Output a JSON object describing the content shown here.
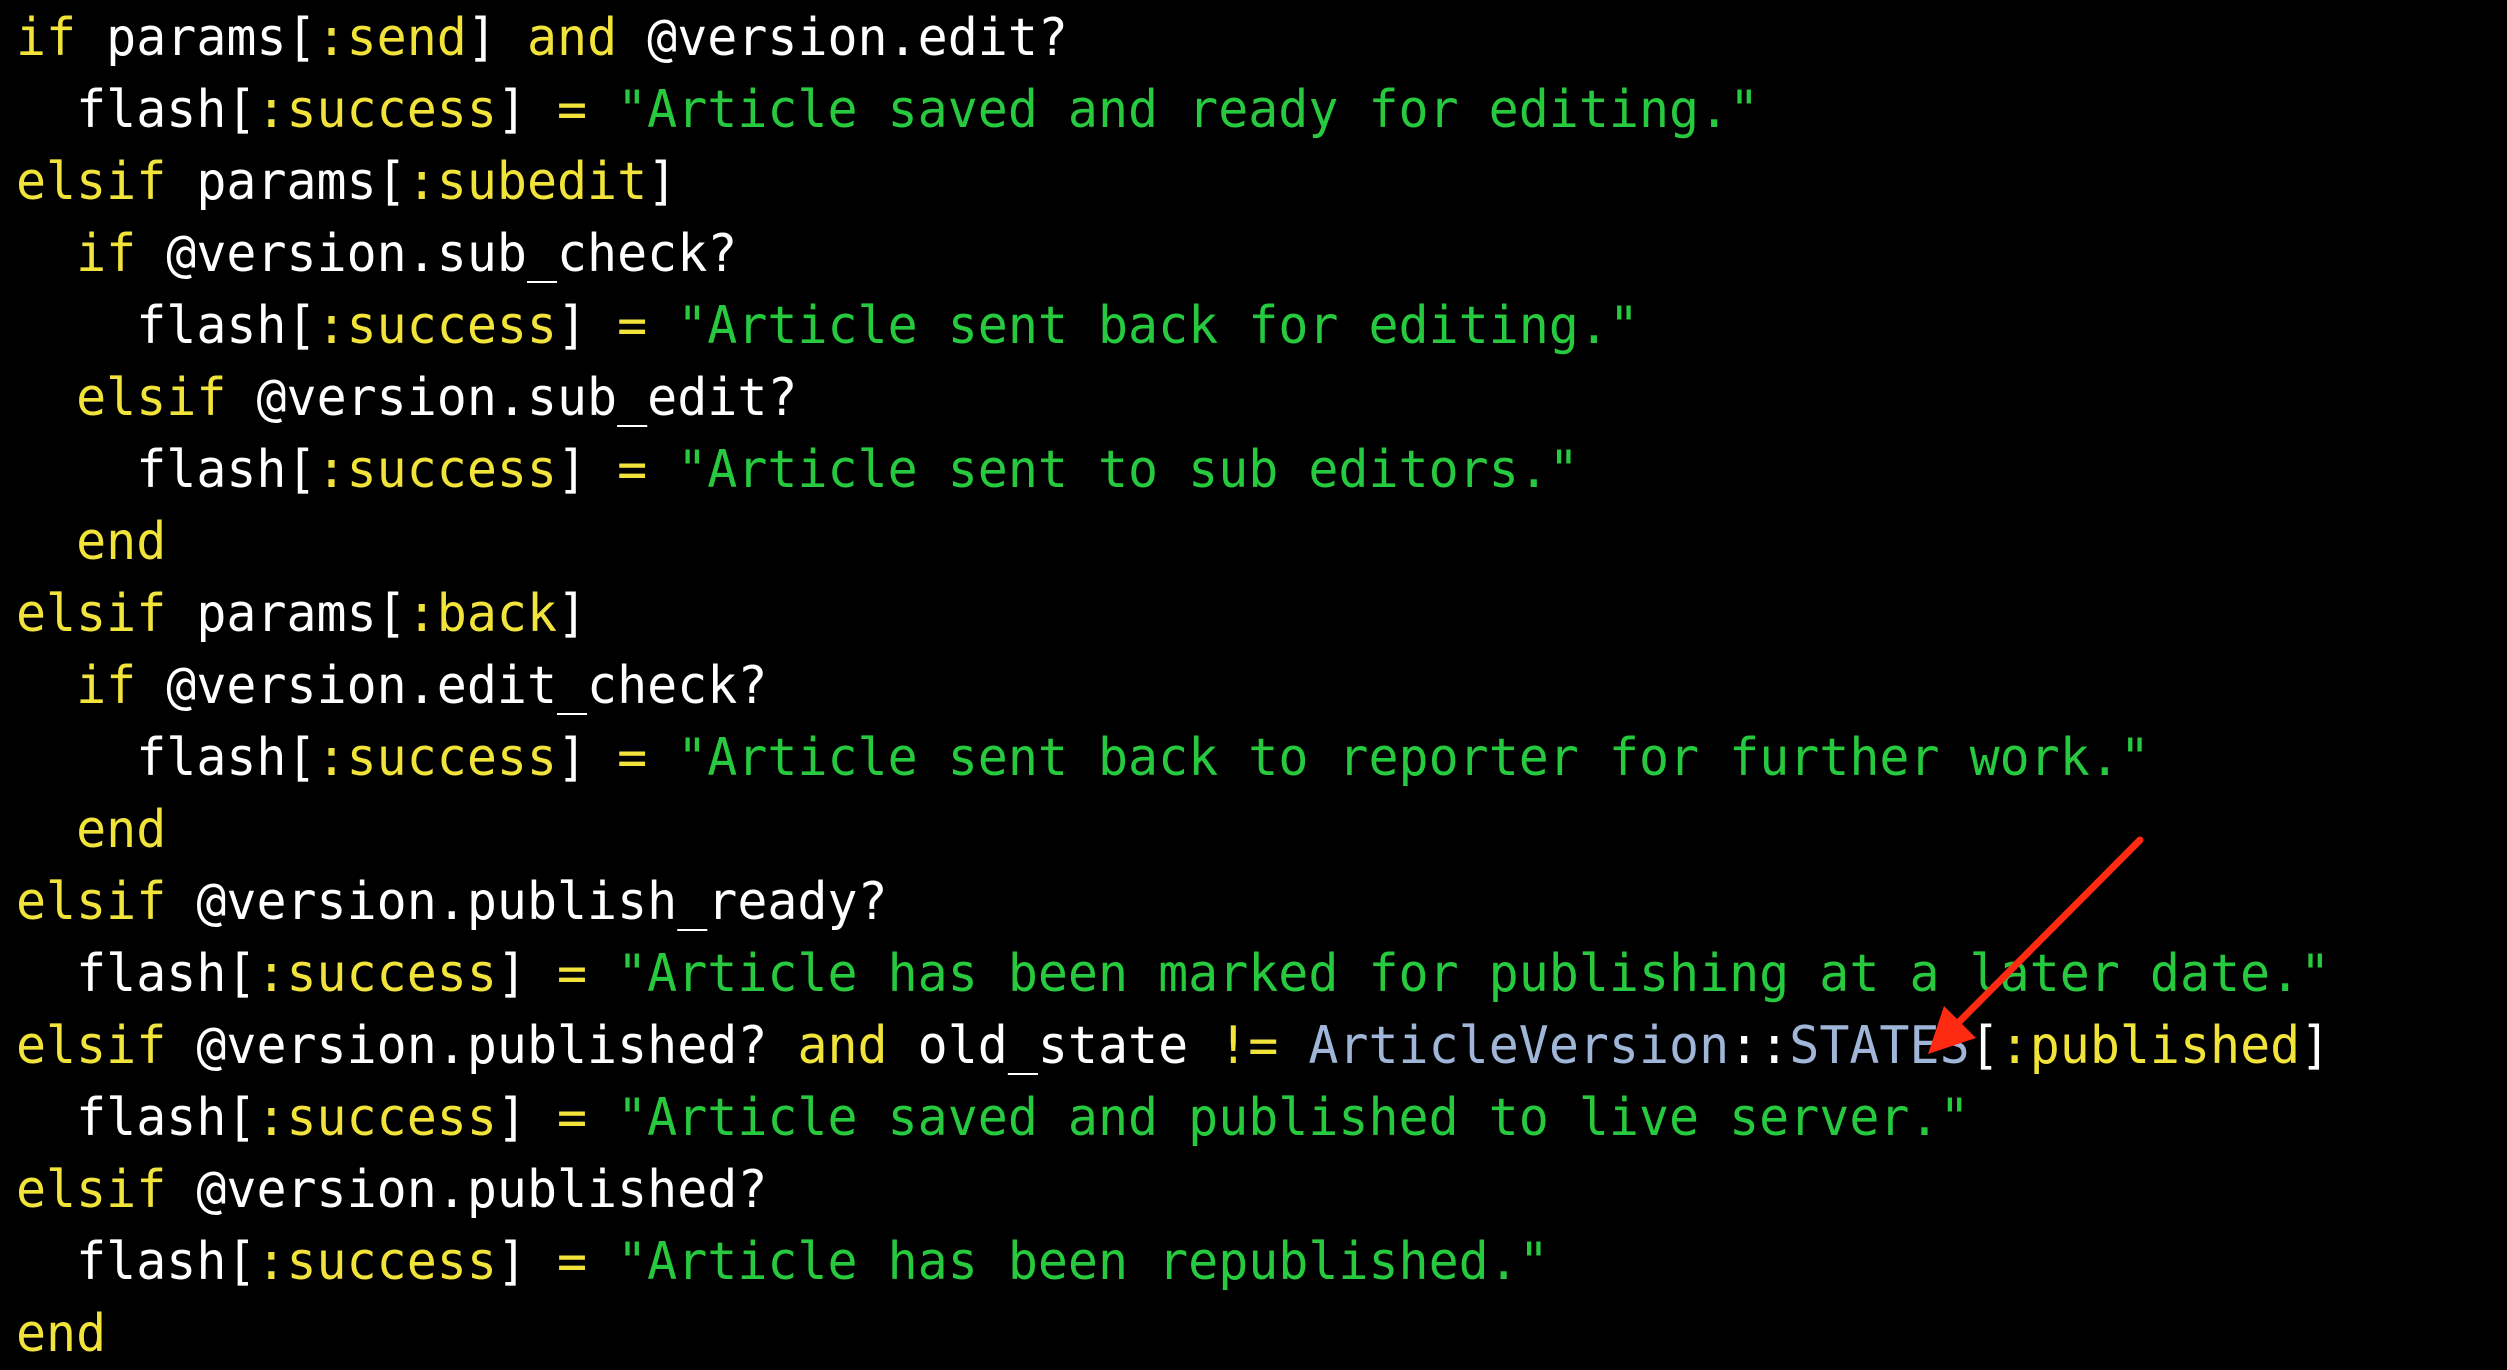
{
  "colors": {
    "background": "#000000",
    "keyword": "#f2e33b",
    "symbol": "#f2e33b",
    "string": "#27c93f",
    "operator": "#f2e33b",
    "constant": "#9fb6d8",
    "plain": "#ffffff",
    "annotation_arrow": "#ff2a12"
  },
  "annotation": {
    "icon": "arrow-icon",
    "points_to": "STATES"
  },
  "code_lines": [
    [
      [
        "keyword",
        "if"
      ],
      [
        "plain",
        " params["
      ],
      [
        "symbol",
        ":send"
      ],
      [
        "plain",
        "] "
      ],
      [
        "keyword",
        "and"
      ],
      [
        "plain",
        " @version.edit?"
      ]
    ],
    [
      [
        "plain",
        "  flash["
      ],
      [
        "symbol",
        ":success"
      ],
      [
        "plain",
        "] "
      ],
      [
        "operator",
        "="
      ],
      [
        "plain",
        " "
      ],
      [
        "string",
        "\"Article saved and ready for editing.\""
      ]
    ],
    [
      [
        "keyword",
        "elsif"
      ],
      [
        "plain",
        " params["
      ],
      [
        "symbol",
        ":subedit"
      ],
      [
        "plain",
        "]"
      ]
    ],
    [
      [
        "plain",
        "  "
      ],
      [
        "keyword",
        "if"
      ],
      [
        "plain",
        " @version.sub_check?"
      ]
    ],
    [
      [
        "plain",
        "    flash["
      ],
      [
        "symbol",
        ":success"
      ],
      [
        "plain",
        "] "
      ],
      [
        "operator",
        "="
      ],
      [
        "plain",
        " "
      ],
      [
        "string",
        "\"Article sent back for editing.\""
      ]
    ],
    [
      [
        "plain",
        "  "
      ],
      [
        "keyword",
        "elsif"
      ],
      [
        "plain",
        " @version.sub_edit?"
      ]
    ],
    [
      [
        "plain",
        "    flash["
      ],
      [
        "symbol",
        ":success"
      ],
      [
        "plain",
        "] "
      ],
      [
        "operator",
        "="
      ],
      [
        "plain",
        " "
      ],
      [
        "string",
        "\"Article sent to sub editors.\""
      ]
    ],
    [
      [
        "plain",
        "  "
      ],
      [
        "keyword",
        "end"
      ]
    ],
    [
      [
        "keyword",
        "elsif"
      ],
      [
        "plain",
        " params["
      ],
      [
        "symbol",
        ":back"
      ],
      [
        "plain",
        "]"
      ]
    ],
    [
      [
        "plain",
        "  "
      ],
      [
        "keyword",
        "if"
      ],
      [
        "plain",
        " @version.edit_check?"
      ]
    ],
    [
      [
        "plain",
        "    flash["
      ],
      [
        "symbol",
        ":success"
      ],
      [
        "plain",
        "] "
      ],
      [
        "operator",
        "="
      ],
      [
        "plain",
        " "
      ],
      [
        "string",
        "\"Article sent back to reporter for further work.\""
      ]
    ],
    [
      [
        "plain",
        "  "
      ],
      [
        "keyword",
        "end"
      ]
    ],
    [
      [
        "keyword",
        "elsif"
      ],
      [
        "plain",
        " @version.publish_ready?"
      ]
    ],
    [
      [
        "plain",
        "  flash["
      ],
      [
        "symbol",
        ":success"
      ],
      [
        "plain",
        "] "
      ],
      [
        "operator",
        "="
      ],
      [
        "plain",
        " "
      ],
      [
        "string",
        "\"Article has been marked for publishing at a later date.\""
      ]
    ],
    [
      [
        "keyword",
        "elsif"
      ],
      [
        "plain",
        " @version.published? "
      ],
      [
        "keyword",
        "and"
      ],
      [
        "plain",
        " old_state "
      ],
      [
        "operator",
        "!="
      ],
      [
        "plain",
        " "
      ],
      [
        "constant",
        "ArticleVersion"
      ],
      [
        "plain",
        "::"
      ],
      [
        "constant",
        "STATES"
      ],
      [
        "plain",
        "["
      ],
      [
        "symbol",
        ":published"
      ],
      [
        "plain",
        "]"
      ]
    ],
    [
      [
        "plain",
        "  flash["
      ],
      [
        "symbol",
        ":success"
      ],
      [
        "plain",
        "] "
      ],
      [
        "operator",
        "="
      ],
      [
        "plain",
        " "
      ],
      [
        "string",
        "\"Article saved and published to live server.\""
      ]
    ],
    [
      [
        "keyword",
        "elsif"
      ],
      [
        "plain",
        " @version.published?"
      ]
    ],
    [
      [
        "plain",
        "  flash["
      ],
      [
        "symbol",
        ":success"
      ],
      [
        "plain",
        "] "
      ],
      [
        "operator",
        "="
      ],
      [
        "plain",
        " "
      ],
      [
        "string",
        "\"Article has been republished.\""
      ]
    ],
    [
      [
        "keyword",
        "end"
      ]
    ]
  ]
}
